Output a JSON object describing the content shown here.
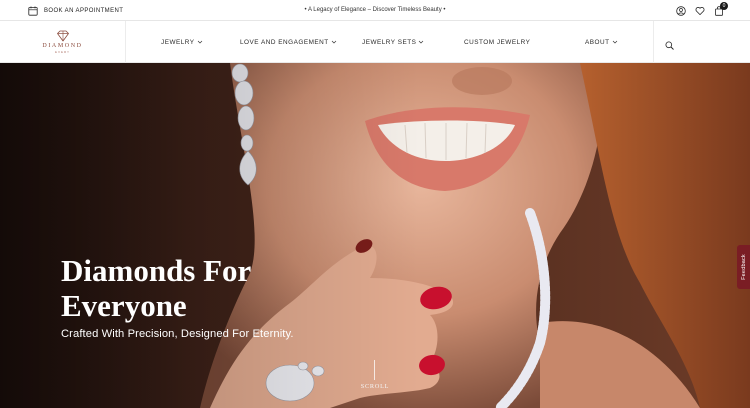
{
  "topbar": {
    "appointment_label": "BOOK AN APPOINTMENT",
    "announcement": "• A Legacy of Elegance – Discover Timeless Beauty •",
    "icons": [
      "calendar-icon",
      "account-icon",
      "heart-icon",
      "bag-icon"
    ],
    "cart_count": "0"
  },
  "header": {
    "logo_name": "DIAMOND",
    "logo_subtitle": "EVERY",
    "nav": [
      {
        "label": "JEWELRY",
        "has_dropdown": true
      },
      {
        "label": "LOVE AND ENGAGEMENT",
        "has_dropdown": true
      },
      {
        "label": "JEWELRY SETS",
        "has_dropdown": true
      },
      {
        "label": "CUSTOM JEWELRY",
        "has_dropdown": false
      },
      {
        "label": "ABOUT",
        "has_dropdown": true
      }
    ],
    "search_icon": "search-icon"
  },
  "hero": {
    "title_line1": "Diamonds For",
    "title_line2": "Everyone",
    "subtitle": "Crafted With Precision, Designed For Eternity.",
    "scroll_label": "SCROLL"
  },
  "feedback_tab": {
    "label": "Feedback"
  },
  "colors": {
    "brand": "#8a4a3c",
    "feedback_tab": "#7a1d24",
    "nail_polish": "#c8102e",
    "text_dark": "#1a1a1a"
  }
}
